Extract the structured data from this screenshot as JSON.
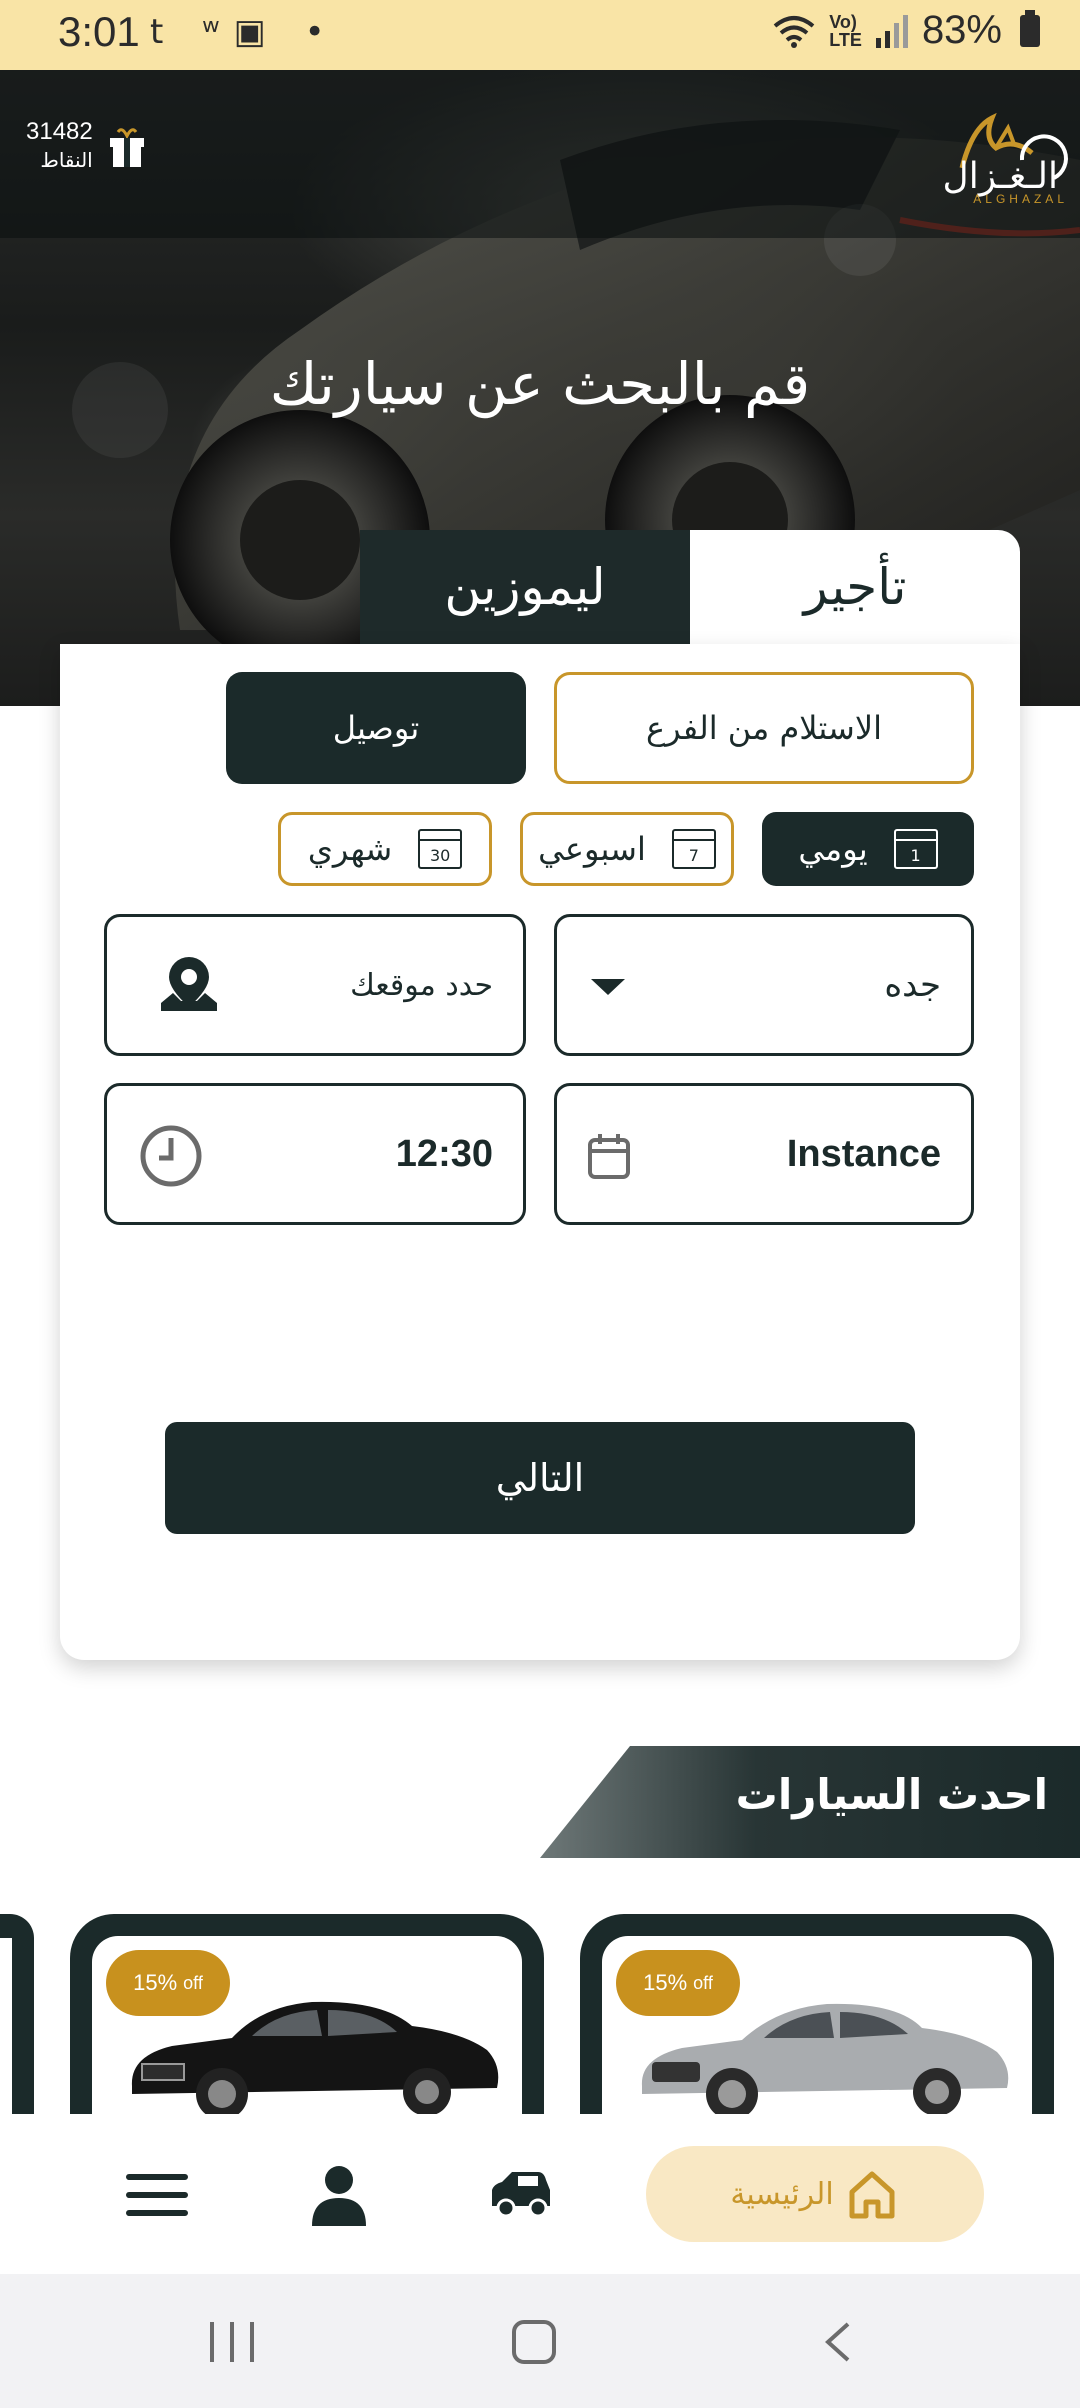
{
  "status_bar": {
    "time": "3:01",
    "left_icons": "t ʷ▣ •",
    "battery": "83%"
  },
  "header": {
    "points_value": "31482",
    "points_label": "النقاط",
    "logo_text": "الـغـزال",
    "logo_sub": "ALGHAZAL"
  },
  "hero": {
    "title": "قم بالبحث عن سيارتك"
  },
  "tabs": {
    "rent": "تأجير",
    "limousine": "ليموزين"
  },
  "booking": {
    "pickup_branch": "الاستلام من الفرع",
    "delivery": "توصيل",
    "periods": [
      {
        "label": "يومي",
        "cal_num": "1",
        "active": true
      },
      {
        "label": "اسبوعي",
        "cal_num": "7",
        "active": false
      },
      {
        "label": "شهري",
        "cal_num": "30",
        "active": false
      }
    ],
    "city_value": "جده",
    "location_placeholder": "حدد موقعك",
    "date_value": "Instance",
    "time_value": "12:30",
    "next_button": "التالي"
  },
  "latest_cars": {
    "title": "احدث السيارات",
    "cars": [
      {
        "discount": "15%",
        "discount_suffix": "off",
        "model": "audi-silver"
      },
      {
        "discount": "15%",
        "discount_suffix": "off",
        "model": "mercedes-black"
      }
    ]
  },
  "bottom_nav": {
    "home_label": "الرئيسية"
  },
  "colors": {
    "primary": "#1b2a2a",
    "gold": "#c8962a",
    "status_bar": "#f9e4a6"
  }
}
